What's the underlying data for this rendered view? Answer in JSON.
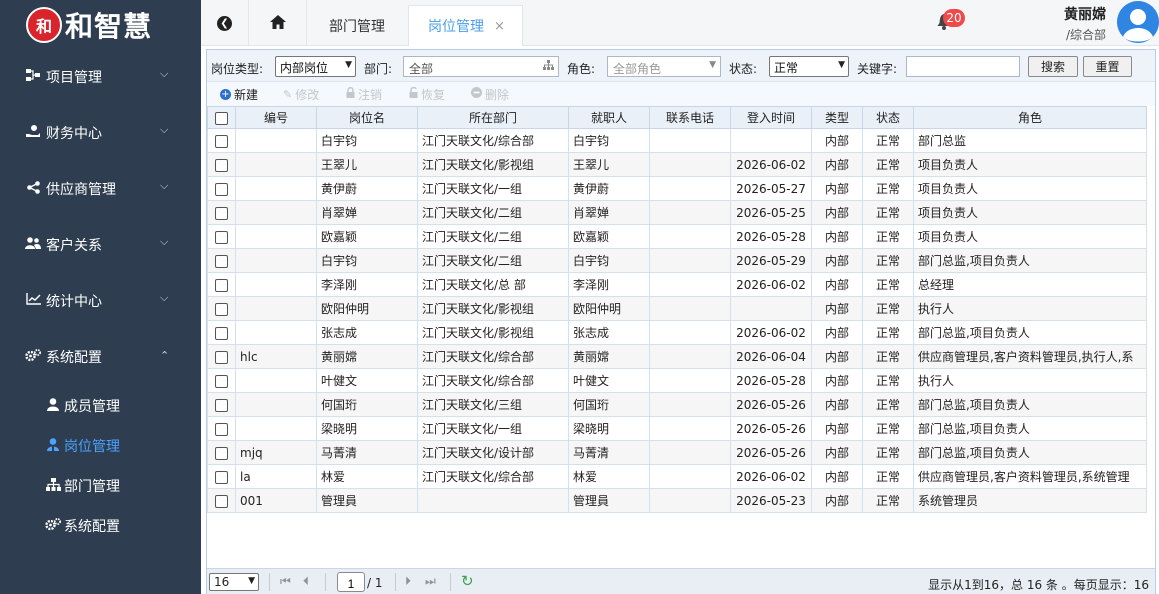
{
  "brand": {
    "logo_mark": "和",
    "name": "和智慧"
  },
  "sidebar": {
    "items": [
      {
        "label": "项目管理",
        "icon": "sitemap-icon",
        "expanded": false
      },
      {
        "label": "财务中心",
        "icon": "hand-coin-icon",
        "expanded": false
      },
      {
        "label": "供应商管理",
        "icon": "share-icon",
        "expanded": false
      },
      {
        "label": "客户关系",
        "icon": "users-icon",
        "expanded": false
      },
      {
        "label": "统计中心",
        "icon": "line-chart-icon",
        "expanded": false
      },
      {
        "label": "系统配置",
        "icon": "cogs-icon",
        "expanded": true
      }
    ],
    "sub_items": [
      {
        "label": "成员管理",
        "icon": "user-icon",
        "active": false
      },
      {
        "label": "岗位管理",
        "icon": "person-badge-icon",
        "active": true
      },
      {
        "label": "部门管理",
        "icon": "sitemap-icon",
        "active": false
      },
      {
        "label": "系统配置",
        "icon": "cogs-icon",
        "active": false
      }
    ]
  },
  "topbar": {
    "tabs": [
      {
        "label": "部门管理",
        "active": false
      },
      {
        "label": "岗位管理",
        "active": true,
        "close": "×"
      }
    ],
    "notification_count": "20",
    "user_name": "黄丽嫦",
    "user_dept": "/综合部"
  },
  "search": {
    "type_label": "岗位类型:",
    "type_value": "内部岗位",
    "dept_label": "部门:",
    "dept_value": "全部",
    "role_label": "角色:",
    "role_placeholder": "全部角色",
    "status_label": "状态:",
    "status_value": "正常",
    "keyword_label": "关键字:",
    "keyword_value": "",
    "search_button": "搜索",
    "reset_button": "重置"
  },
  "toolbar": {
    "new": "新建",
    "edit": "修改",
    "cancel": "注销",
    "restore": "恢复",
    "delete": "删除"
  },
  "table": {
    "columns": [
      "编号",
      "岗位名",
      "所在部门",
      "就职人",
      "联系电话",
      "登入时间",
      "类型",
      "状态",
      "角色"
    ],
    "rows": [
      {
        "code": "",
        "name": "白宇钧",
        "dept": "江门天联文化/综合部",
        "person": "白宇钧",
        "phone": "",
        "login": "",
        "type": "内部",
        "status": "正常",
        "role": "部门总监"
      },
      {
        "code": "",
        "name": "王翠儿",
        "dept": "江门天联文化/影视组",
        "person": "王翠儿",
        "phone": "",
        "login": "2026-06-02",
        "type": "内部",
        "status": "正常",
        "role": "项目负责人"
      },
      {
        "code": "",
        "name": "黄伊蔚",
        "dept": "江门天联文化/一组",
        "person": "黄伊蔚",
        "phone": "",
        "login": "2026-05-27",
        "type": "内部",
        "status": "正常",
        "role": "项目负责人"
      },
      {
        "code": "",
        "name": "肖翠婵",
        "dept": "江门天联文化/二组",
        "person": "肖翠婵",
        "phone": "",
        "login": "2026-05-25",
        "type": "内部",
        "status": "正常",
        "role": "项目负责人"
      },
      {
        "code": "",
        "name": "欧嘉颖",
        "dept": "江门天联文化/二组",
        "person": "欧嘉颖",
        "phone": "",
        "login": "2026-05-28",
        "type": "内部",
        "status": "正常",
        "role": "项目负责人"
      },
      {
        "code": "",
        "name": "白宇钧",
        "dept": "江门天联文化/二组",
        "person": "白宇钧",
        "phone": "",
        "login": "2026-05-29",
        "type": "内部",
        "status": "正常",
        "role": "部门总监,项目负责人"
      },
      {
        "code": "",
        "name": "李泽刚",
        "dept": "江门天联文化/总 部",
        "person": "李泽刚",
        "phone": "",
        "login": "2026-06-02",
        "type": "内部",
        "status": "正常",
        "role": "总经理"
      },
      {
        "code": "",
        "name": "欧阳仲明",
        "dept": "江门天联文化/影视组",
        "person": "欧阳仲明",
        "phone": "",
        "login": "",
        "type": "内部",
        "status": "正常",
        "role": "执行人"
      },
      {
        "code": "",
        "name": "张志成",
        "dept": "江门天联文化/影视组",
        "person": "张志成",
        "phone": "",
        "login": "2026-06-02",
        "type": "内部",
        "status": "正常",
        "role": "部门总监,项目负责人"
      },
      {
        "code": "hlc",
        "name": "黄丽嫦",
        "dept": "江门天联文化/综合部",
        "person": "黄丽嫦",
        "phone": "",
        "login": "2026-06-04",
        "type": "内部",
        "status": "正常",
        "role": "供应商管理员,客户资料管理员,执行人,系"
      },
      {
        "code": "",
        "name": "叶健文",
        "dept": "江门天联文化/综合部",
        "person": "叶健文",
        "phone": "",
        "login": "2026-05-28",
        "type": "内部",
        "status": "正常",
        "role": "执行人"
      },
      {
        "code": "",
        "name": "何国珩",
        "dept": "江门天联文化/三组",
        "person": "何国珩",
        "phone": "",
        "login": "2026-05-26",
        "type": "内部",
        "status": "正常",
        "role": "部门总监,项目负责人"
      },
      {
        "code": "",
        "name": "梁晓明",
        "dept": "江门天联文化/一组",
        "person": "梁晓明",
        "phone": "",
        "login": "2026-05-26",
        "type": "内部",
        "status": "正常",
        "role": "部门总监,项目负责人"
      },
      {
        "code": "mjq",
        "name": "马菁清",
        "dept": "江门天联文化/设计部",
        "person": "马菁清",
        "phone": "",
        "login": "2026-05-26",
        "type": "内部",
        "status": "正常",
        "role": "部门总监,项目负责人"
      },
      {
        "code": "la",
        "name": "林爱",
        "dept": "江门天联文化/综合部",
        "person": "林爱",
        "phone": "",
        "login": "2026-06-02",
        "type": "内部",
        "status": "正常",
        "role": "供应商管理员,客户资料管理员,系统管理"
      },
      {
        "code": "001",
        "name": "管理員",
        "dept": "",
        "person": "管理員",
        "phone": "",
        "login": "2026-05-23",
        "type": "内部",
        "status": "正常",
        "role": "系统管理员"
      }
    ]
  },
  "pager": {
    "page_size": "16",
    "current_page": "1",
    "total_pages": "/ 1",
    "info": "显示从1到16，总 16 条 。每页显示：16"
  },
  "colors": {
    "sidebar": "#2e3d4f",
    "accent": "#4a9ee8",
    "badge": "#ef4b4b"
  }
}
